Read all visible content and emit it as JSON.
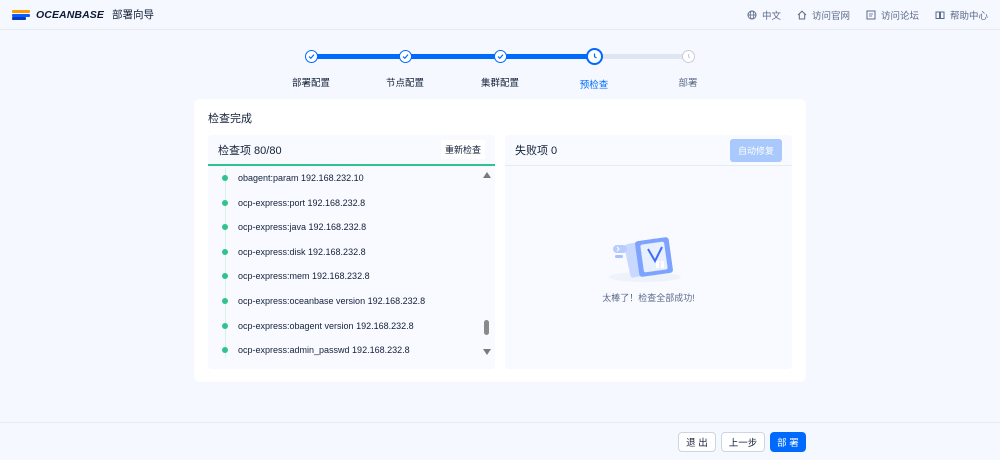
{
  "header": {
    "logo_text": "OCEANBASE",
    "app_title": "部署向导",
    "links": [
      {
        "label": "中文",
        "icon": "globe-icon"
      },
      {
        "label": "访问官网",
        "icon": "home-icon"
      },
      {
        "label": "访问论坛",
        "icon": "forum-icon"
      },
      {
        "label": "帮助中心",
        "icon": "book-icon"
      }
    ]
  },
  "steps": [
    {
      "label": "部署配置",
      "status": "done"
    },
    {
      "label": "节点配置",
      "status": "done"
    },
    {
      "label": "集群配置",
      "status": "done"
    },
    {
      "label": "预检查",
      "status": "current"
    },
    {
      "label": "部署",
      "status": "pending"
    }
  ],
  "card": {
    "title": "检查完成",
    "left": {
      "title": "检查项 80/80",
      "recheck_label": "重新检查",
      "items": [
        "obagent:param 192.168.232.10",
        "ocp-express:port 192.168.232.8",
        "ocp-express:java 192.168.232.8",
        "ocp-express:disk 192.168.232.8",
        "ocp-express:mem 192.168.232.8",
        "ocp-express:oceanbase version 192.168.232.8",
        "ocp-express:obagent version 192.168.232.8",
        "ocp-express:admin_passwd 192.168.232.8"
      ]
    },
    "right": {
      "title": "失败项 0",
      "autofix_label": "自动修复",
      "empty_text": "太棒了！检查全部成功!"
    }
  },
  "footer": {
    "exit_label": "退 出",
    "prev_label": "上一步",
    "deploy_label": "部 署"
  },
  "colors": {
    "primary": "#006aff",
    "success": "#2fc48d",
    "background": "#f5f8fe"
  }
}
